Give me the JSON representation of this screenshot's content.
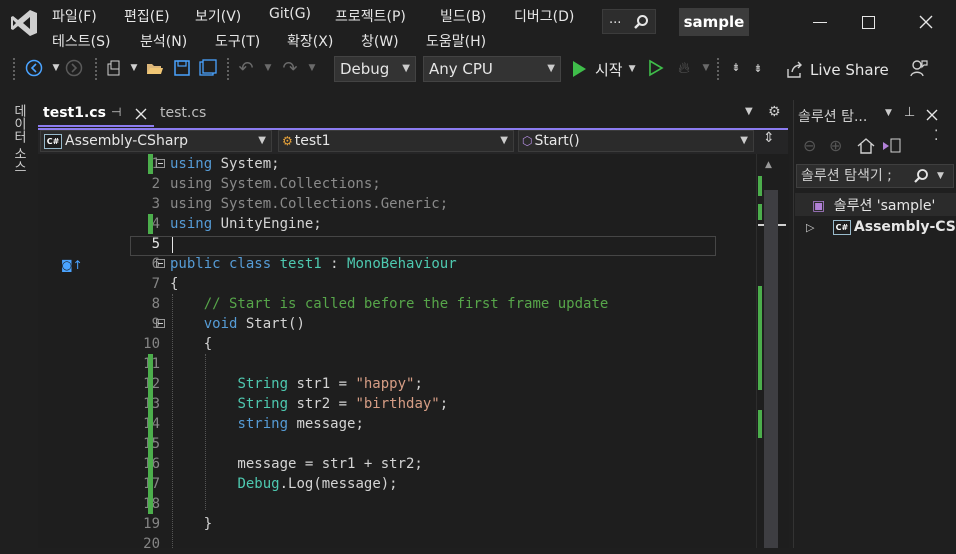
{
  "menu": {
    "row1": [
      "파일(F)",
      "편집(E)",
      "보기(V)",
      "Git(G)",
      "프로젝트(P)",
      "빌드(B)",
      "디버그(D)"
    ],
    "row2": [
      "테스트(S)",
      "분석(N)",
      "도구(T)",
      "확장(X)",
      "창(W)",
      "도움말(H)"
    ],
    "search_dots": "...",
    "solution_badge": "sample"
  },
  "toolbar": {
    "config": "Debug",
    "platform": "Any CPU",
    "start_label": "시작",
    "live_share": "Live Share"
  },
  "left_tab": "데이터 소스",
  "tabs": [
    {
      "label": "test1.cs",
      "active": true
    },
    {
      "label": "test.cs",
      "active": false
    }
  ],
  "navbar": {
    "project": "Assembly-CSharp",
    "class": "test1",
    "member": "Start()"
  },
  "code_lines": [
    {
      "n": "1",
      "t": [
        [
          "kw",
          "using"
        ],
        [
          "pl",
          " System;"
        ]
      ]
    },
    {
      "n": "2",
      "t": [
        [
          "dim",
          "using System.Collections;"
        ]
      ]
    },
    {
      "n": "3",
      "t": [
        [
          "dim",
          "using System.Collections.Generic;"
        ]
      ]
    },
    {
      "n": "4",
      "t": [
        [
          "kw",
          "using"
        ],
        [
          "pl",
          " UnityEngine;"
        ]
      ]
    },
    {
      "n": "5",
      "t": []
    },
    {
      "n": "6",
      "t": [
        [
          "kw",
          "public class"
        ],
        [
          "pl",
          " "
        ],
        [
          "cls",
          "test1"
        ],
        [
          "pl",
          " : "
        ],
        [
          "cls",
          "MonoBehaviour"
        ]
      ]
    },
    {
      "n": "7",
      "t": [
        [
          "pl",
          "{"
        ]
      ]
    },
    {
      "n": "8",
      "t": [
        [
          "pl",
          "    "
        ],
        [
          "cmt",
          "// Start is called before the first frame update"
        ]
      ]
    },
    {
      "n": "9",
      "t": [
        [
          "pl",
          "    "
        ],
        [
          "kw",
          "void"
        ],
        [
          "pl",
          " Start()"
        ]
      ]
    },
    {
      "n": "10",
      "t": [
        [
          "pl",
          "    {"
        ]
      ]
    },
    {
      "n": "11",
      "t": []
    },
    {
      "n": "12",
      "t": [
        [
          "pl",
          "        "
        ],
        [
          "cls",
          "String"
        ],
        [
          "pl",
          " str1 = "
        ],
        [
          "str",
          "\"happy\""
        ],
        [
          "pl",
          ";"
        ]
      ]
    },
    {
      "n": "13",
      "t": [
        [
          "pl",
          "        "
        ],
        [
          "cls",
          "String"
        ],
        [
          "pl",
          " str2 = "
        ],
        [
          "str",
          "\"birthday\""
        ],
        [
          "pl",
          ";"
        ]
      ]
    },
    {
      "n": "14",
      "t": [
        [
          "pl",
          "        "
        ],
        [
          "kw",
          "string"
        ],
        [
          "pl",
          " message;"
        ]
      ]
    },
    {
      "n": "15",
      "t": []
    },
    {
      "n": "16",
      "t": [
        [
          "pl",
          "        message = str1 + str2;"
        ]
      ]
    },
    {
      "n": "17",
      "t": [
        [
          "pl",
          "        "
        ],
        [
          "cls",
          "Debug"
        ],
        [
          "pl",
          "."
        ],
        [
          "pl",
          "Log(message);"
        ]
      ]
    },
    {
      "n": "18",
      "t": []
    },
    {
      "n": "19",
      "t": [
        [
          "pl",
          "    }"
        ]
      ]
    },
    {
      "n": "20",
      "t": []
    }
  ],
  "solution_explorer": {
    "title": "솔루션 탐...",
    "search_placeholder": "솔루션 탐색기 ;",
    "solution_label": "솔루션 'sample'",
    "project_label": "Assembly-CS"
  },
  "colors": {
    "accent": "#8c7cf0",
    "change_bar": "#4cae4c",
    "keyword": "#569cd6",
    "type": "#4ec9b0",
    "string": "#d69d85",
    "comment": "#57a64a"
  }
}
